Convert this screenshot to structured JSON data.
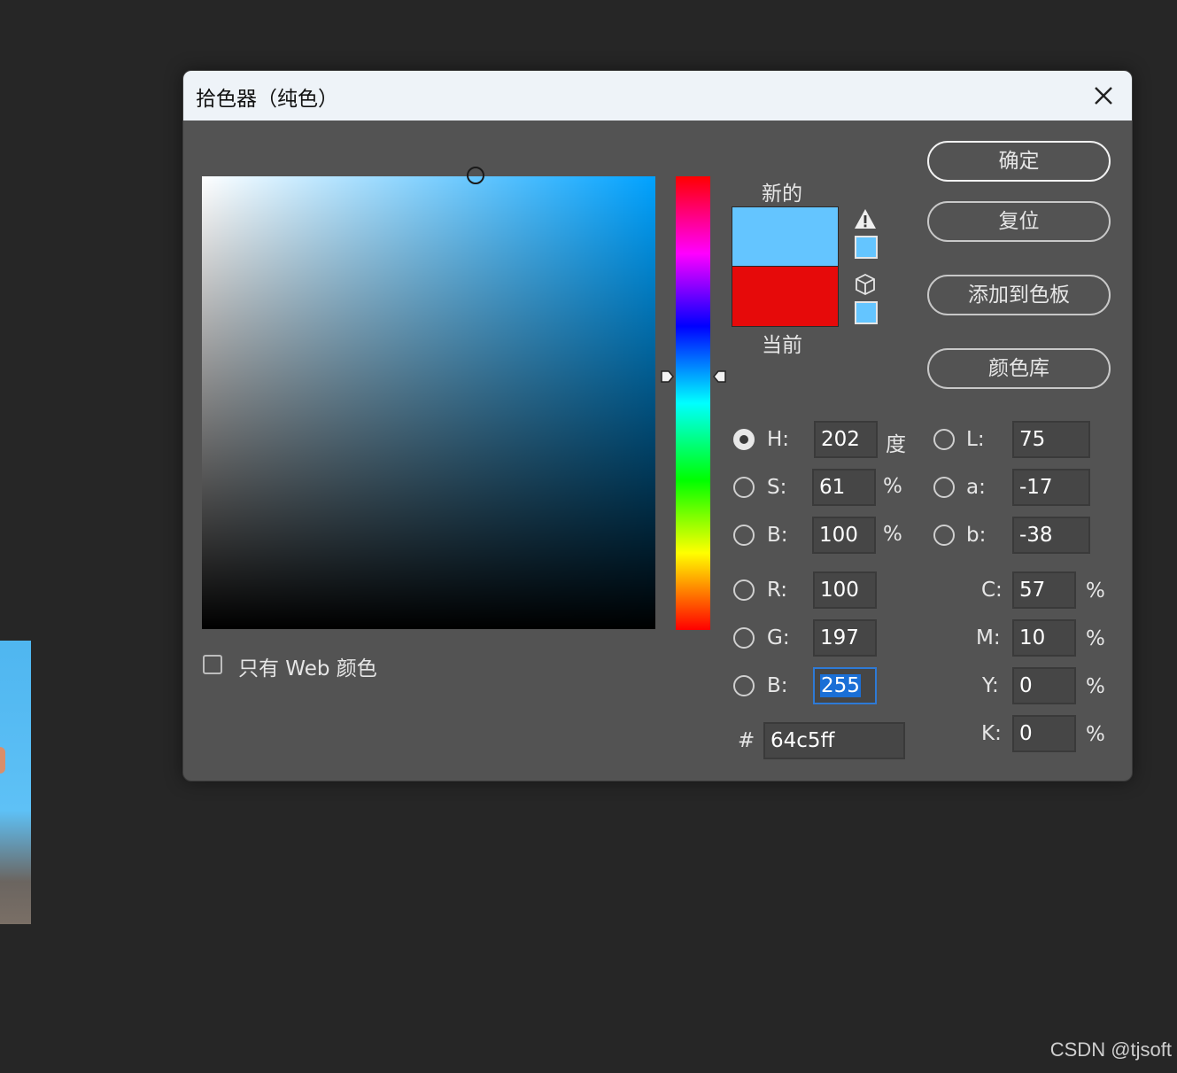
{
  "dialog": {
    "title": "拾色器（纯色）",
    "new_label": "新的",
    "current_label": "当前",
    "new_color": "#64c5ff",
    "current_color": "#e60a0a"
  },
  "buttons": {
    "ok": "确定",
    "reset": "复位",
    "add_to_swatches": "添加到色板",
    "color_libraries": "颜色库"
  },
  "hsb": {
    "h": {
      "label": "H:",
      "value": "202",
      "unit": "度",
      "selected": true
    },
    "s": {
      "label": "S:",
      "value": "61",
      "unit": "%"
    },
    "b": {
      "label": "B:",
      "value": "100",
      "unit": "%"
    }
  },
  "rgb": {
    "r": {
      "label": "R:",
      "value": "100"
    },
    "g": {
      "label": "G:",
      "value": "197"
    },
    "b": {
      "label": "B:",
      "value": "255"
    }
  },
  "lab": {
    "l": {
      "label": "L:",
      "value": "75"
    },
    "a": {
      "label": "a:",
      "value": "-17"
    },
    "b": {
      "label": "b:",
      "value": "-38"
    }
  },
  "cmyk": {
    "c": {
      "label": "C:",
      "value": "57",
      "unit": "%"
    },
    "m": {
      "label": "M:",
      "value": "10",
      "unit": "%"
    },
    "y": {
      "label": "Y:",
      "value": "0",
      "unit": "%"
    },
    "k": {
      "label": "K:",
      "value": "0",
      "unit": "%"
    }
  },
  "hex": {
    "label": "#",
    "value": "64c5ff"
  },
  "web_only": {
    "label": "只有 Web 颜色",
    "checked": false
  },
  "watermark": "CSDN @tjsoft",
  "icons": {
    "close": "close-icon",
    "gamut_warning": "warning-icon",
    "web_safe": "cube-icon"
  }
}
